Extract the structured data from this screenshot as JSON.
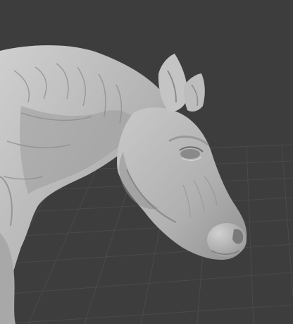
{
  "viewport": {
    "background_color": "#3d3d3d",
    "grid_line_color": "#4a4a4a",
    "grid_visible": true
  },
  "model": {
    "subject": "horse-sculpt",
    "material": "clay",
    "base_color": "#b8b8b8",
    "shadow_color": "#6e6e6e",
    "highlight_color": "#d6d6d6"
  }
}
